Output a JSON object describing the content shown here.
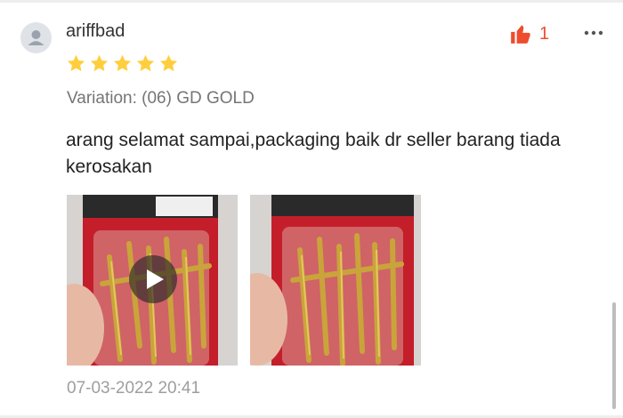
{
  "review": {
    "username": "ariffbad",
    "rating": 5,
    "rating_max": 5,
    "likes": "1",
    "variation": "Variation: (06) GD GOLD",
    "text": "arang selamat sampai,packaging baik dr seller barang tiada kerosakan",
    "timestamp": "07-03-2022 20:41",
    "media": [
      {
        "type": "video",
        "icon": "play-icon"
      },
      {
        "type": "image"
      }
    ]
  },
  "colors": {
    "accent": "#ee4d2d",
    "star": "#ffce3d",
    "muted": "#757575",
    "timestamp": "#9e9e9e"
  },
  "icons": {
    "avatar": "user-avatar-icon",
    "like": "thumbs-up-icon",
    "more": "more-options-icon",
    "star": "star-icon"
  }
}
